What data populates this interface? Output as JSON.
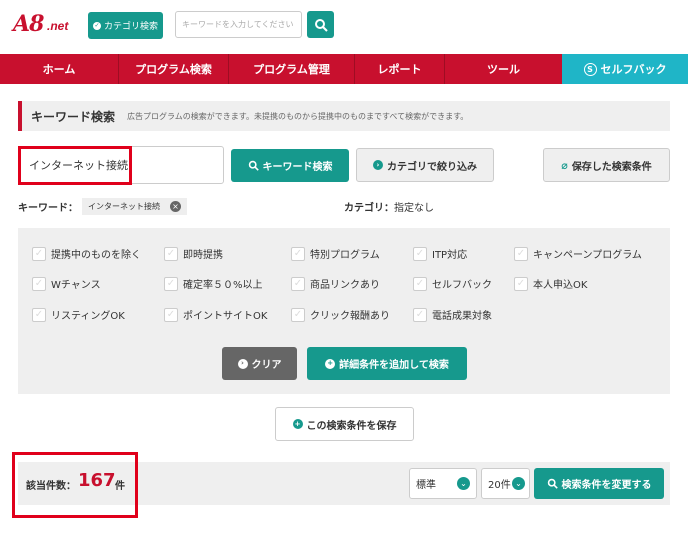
{
  "header": {
    "logo_main": "A8",
    "logo_net": ".net",
    "category_button": "カテゴリ検索",
    "search_placeholder": "キーワードを入力してください"
  },
  "nav": {
    "items": [
      {
        "label": "ホーム"
      },
      {
        "label": "プログラム検索"
      },
      {
        "label": "プログラム管理"
      },
      {
        "label": "レポート"
      },
      {
        "label": "ツール"
      },
      {
        "label": "セルフバック"
      }
    ]
  },
  "keyword_search": {
    "title": "キーワード検索",
    "description": "広告プログラムの検索ができます。未提携のものから提携中のものまですべて検索ができます。",
    "input_value": "インターネット接続",
    "search_button": "キーワード検索",
    "narrow_button": "カテゴリで絞り込み",
    "saved_button": "保存した検索条件",
    "keyword_label": "キーワード：",
    "keyword_tag": "インターネット接続",
    "category_label": "カテゴリ：",
    "category_value": "指定なし"
  },
  "filters": {
    "options": [
      {
        "label": "提携中のものを除く"
      },
      {
        "label": "即時提携"
      },
      {
        "label": "特別プログラム"
      },
      {
        "label": "ITP対応"
      },
      {
        "label": "キャンペーンプログラム"
      },
      {
        "label": "Wチャンス"
      },
      {
        "label": "確定率５０%以上"
      },
      {
        "label": "商品リンクあり"
      },
      {
        "label": "セルフバック"
      },
      {
        "label": "本人申込OK"
      },
      {
        "label": "リスティングOK"
      },
      {
        "label": "ポイントサイトOK"
      },
      {
        "label": "クリック報酬あり"
      },
      {
        "label": "電話成果対象"
      }
    ],
    "clear_button": "クリア",
    "add_detail_button": "詳細条件を追加して検索",
    "save_button": "この検索条件を保存"
  },
  "results": {
    "label": "該当件数：",
    "count": "167",
    "unit": "件",
    "sort_value": "標準",
    "per_page_value": "20件",
    "change_button": "検索条件を変更する"
  },
  "colors": {
    "brand_red": "#c8102e",
    "teal": "#16998d",
    "selfback_blue": "#1fb5c7",
    "highlight_red": "#e0001b"
  }
}
